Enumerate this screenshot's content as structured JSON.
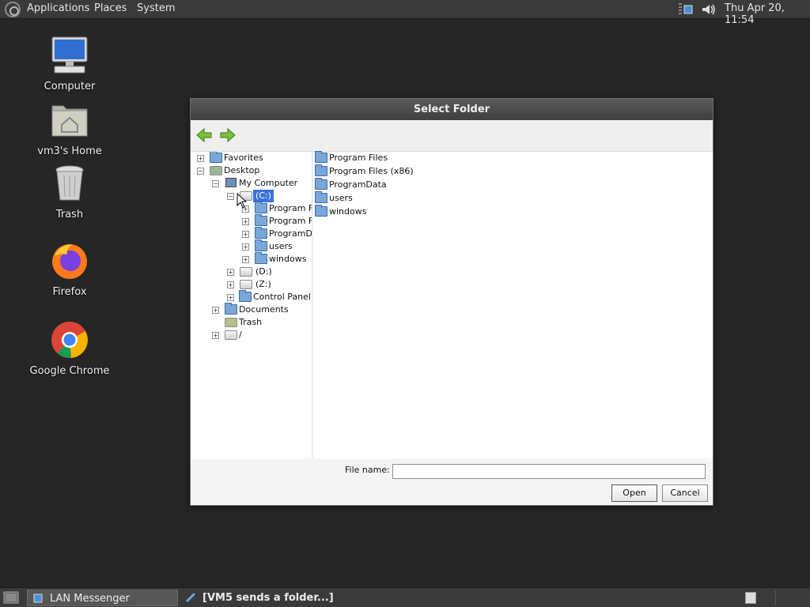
{
  "top_panel": {
    "menus": [
      "Applications",
      "Places",
      "System"
    ],
    "clock": "Thu Apr 20, 11:54"
  },
  "desktop_icons": [
    {
      "label": "Computer",
      "icon": "computer-icon"
    },
    {
      "label": "vm3's Home",
      "icon": "home-folder-icon"
    },
    {
      "label": "Trash",
      "icon": "trash-icon"
    },
    {
      "label": "Firefox",
      "icon": "firefox-icon"
    },
    {
      "label": "Google Chrome",
      "icon": "chrome-icon"
    }
  ],
  "dialog": {
    "title": "Select Folder",
    "tree": [
      {
        "label": "Favorites",
        "expander": "+",
        "icon": "folder-icon"
      },
      {
        "label": "Desktop",
        "expander": "−",
        "icon": "desktop-icon"
      },
      {
        "label": "My Computer",
        "expander": "−",
        "icon": "computer-icon"
      },
      {
        "label": "(C:)",
        "expander": "−",
        "icon": "drive-icon",
        "selected": true
      },
      {
        "label": "Program Fi",
        "expander": "+",
        "icon": "folder-icon"
      },
      {
        "label": "Program Fi",
        "expander": "+",
        "icon": "folder-icon"
      },
      {
        "label": "ProgramDa",
        "expander": "+",
        "icon": "folder-icon"
      },
      {
        "label": "users",
        "expander": "+",
        "icon": "folder-icon"
      },
      {
        "label": "windows",
        "expander": "+",
        "icon": "folder-icon"
      },
      {
        "label": "(D:)",
        "expander": "+",
        "icon": "drive-icon"
      },
      {
        "label": "(Z:)",
        "expander": "+",
        "icon": "drive-icon"
      },
      {
        "label": "Control Panel",
        "expander": "+",
        "icon": "folder-icon"
      },
      {
        "label": "Documents",
        "expander": "+",
        "icon": "folder-icon"
      },
      {
        "label": "Trash",
        "expander": "",
        "icon": "trash-icon"
      },
      {
        "label": "/",
        "expander": "+",
        "icon": "drive-icon"
      }
    ],
    "list": [
      "Program Files",
      "Program Files (x86)",
      "ProgramData",
      "users",
      "windows"
    ],
    "file_name_label": "File name:",
    "file_name_value": "",
    "open_label": "Open",
    "cancel_label": "Cancel"
  },
  "taskbar": {
    "tasks": [
      "LAN Messenger",
      "[VM5 sends a folder...]"
    ]
  }
}
